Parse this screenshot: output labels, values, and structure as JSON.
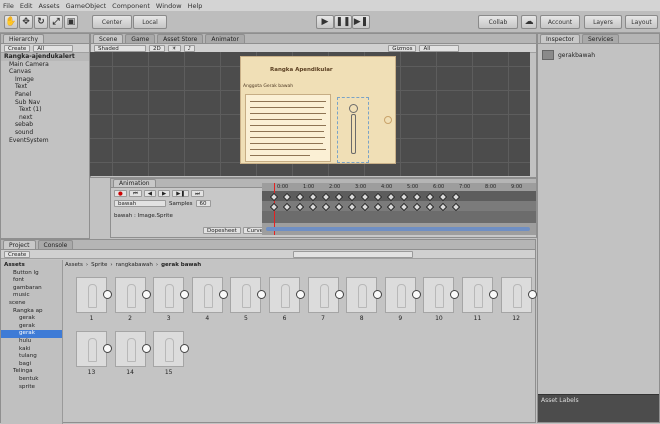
{
  "menu": [
    "File",
    "Edit",
    "Assets",
    "GameObject",
    "Component",
    "Window",
    "Help"
  ],
  "toolbar": {
    "pivot_label": "Center",
    "space_label": "Local",
    "collab_label": "Collab",
    "account_label": "Account",
    "layers_label": "Layers",
    "layout_label": "Layout"
  },
  "hierarchy": {
    "tab": "Hierarchy",
    "create_label": "Create",
    "search_placeholder": "All",
    "scene_name": "Rangka-ajendukalert",
    "items": [
      "Main Camera",
      "Canvas",
      "Image",
      "Text",
      "Panel",
      "Sub Nav",
      "Text (1)",
      "next",
      "sebab",
      "sound",
      "EventSystem"
    ]
  },
  "scene": {
    "tabs": [
      "Scene",
      "Game",
      "Asset Store",
      "Animator"
    ],
    "shading": "Shaded",
    "mode_2d": "2D",
    "gizmos": "Gizmos",
    "search": "All",
    "book_title": "Rangka Apendikular",
    "book_heading": "Anggota Gerak bawah"
  },
  "animator": {
    "tab": "Animation",
    "clip": "bawah",
    "samples_label": "Samples",
    "samples_value": "60",
    "property": "bawah : Image.Sprite",
    "ticks": [
      "0:00",
      "1:00",
      "2:00",
      "3:00",
      "4:00",
      "5:00",
      "6:00",
      "7:00",
      "8:00",
      "9:00"
    ],
    "dopesheet_label": "Dopesheet",
    "curves_label": "Curves"
  },
  "project": {
    "tabs": [
      "Project",
      "Console"
    ],
    "create_label": "Create",
    "breadcrumb": [
      "Assets",
      "Sprite",
      "rangkabawah",
      "gerak bawah"
    ],
    "tree": [
      "Assets",
      "Button lg",
      "font",
      "gambaran",
      "music",
      "scene",
      "Rangka ap",
      "gerak",
      "gerak",
      "gerak",
      "hulu",
      "kaki",
      "tulang",
      "bagi",
      "Telinga",
      "bentuk",
      "sprite"
    ],
    "selected_index": 9,
    "thumbs": [
      "1",
      "2",
      "3",
      "4",
      "5",
      "6",
      "7",
      "8",
      "9",
      "10",
      "11",
      "12",
      "13",
      "14",
      "15"
    ]
  },
  "inspector": {
    "tabs": [
      "Inspector",
      "Services"
    ],
    "item_name": "gerakbawah",
    "asset_labels": "Asset Labels"
  }
}
